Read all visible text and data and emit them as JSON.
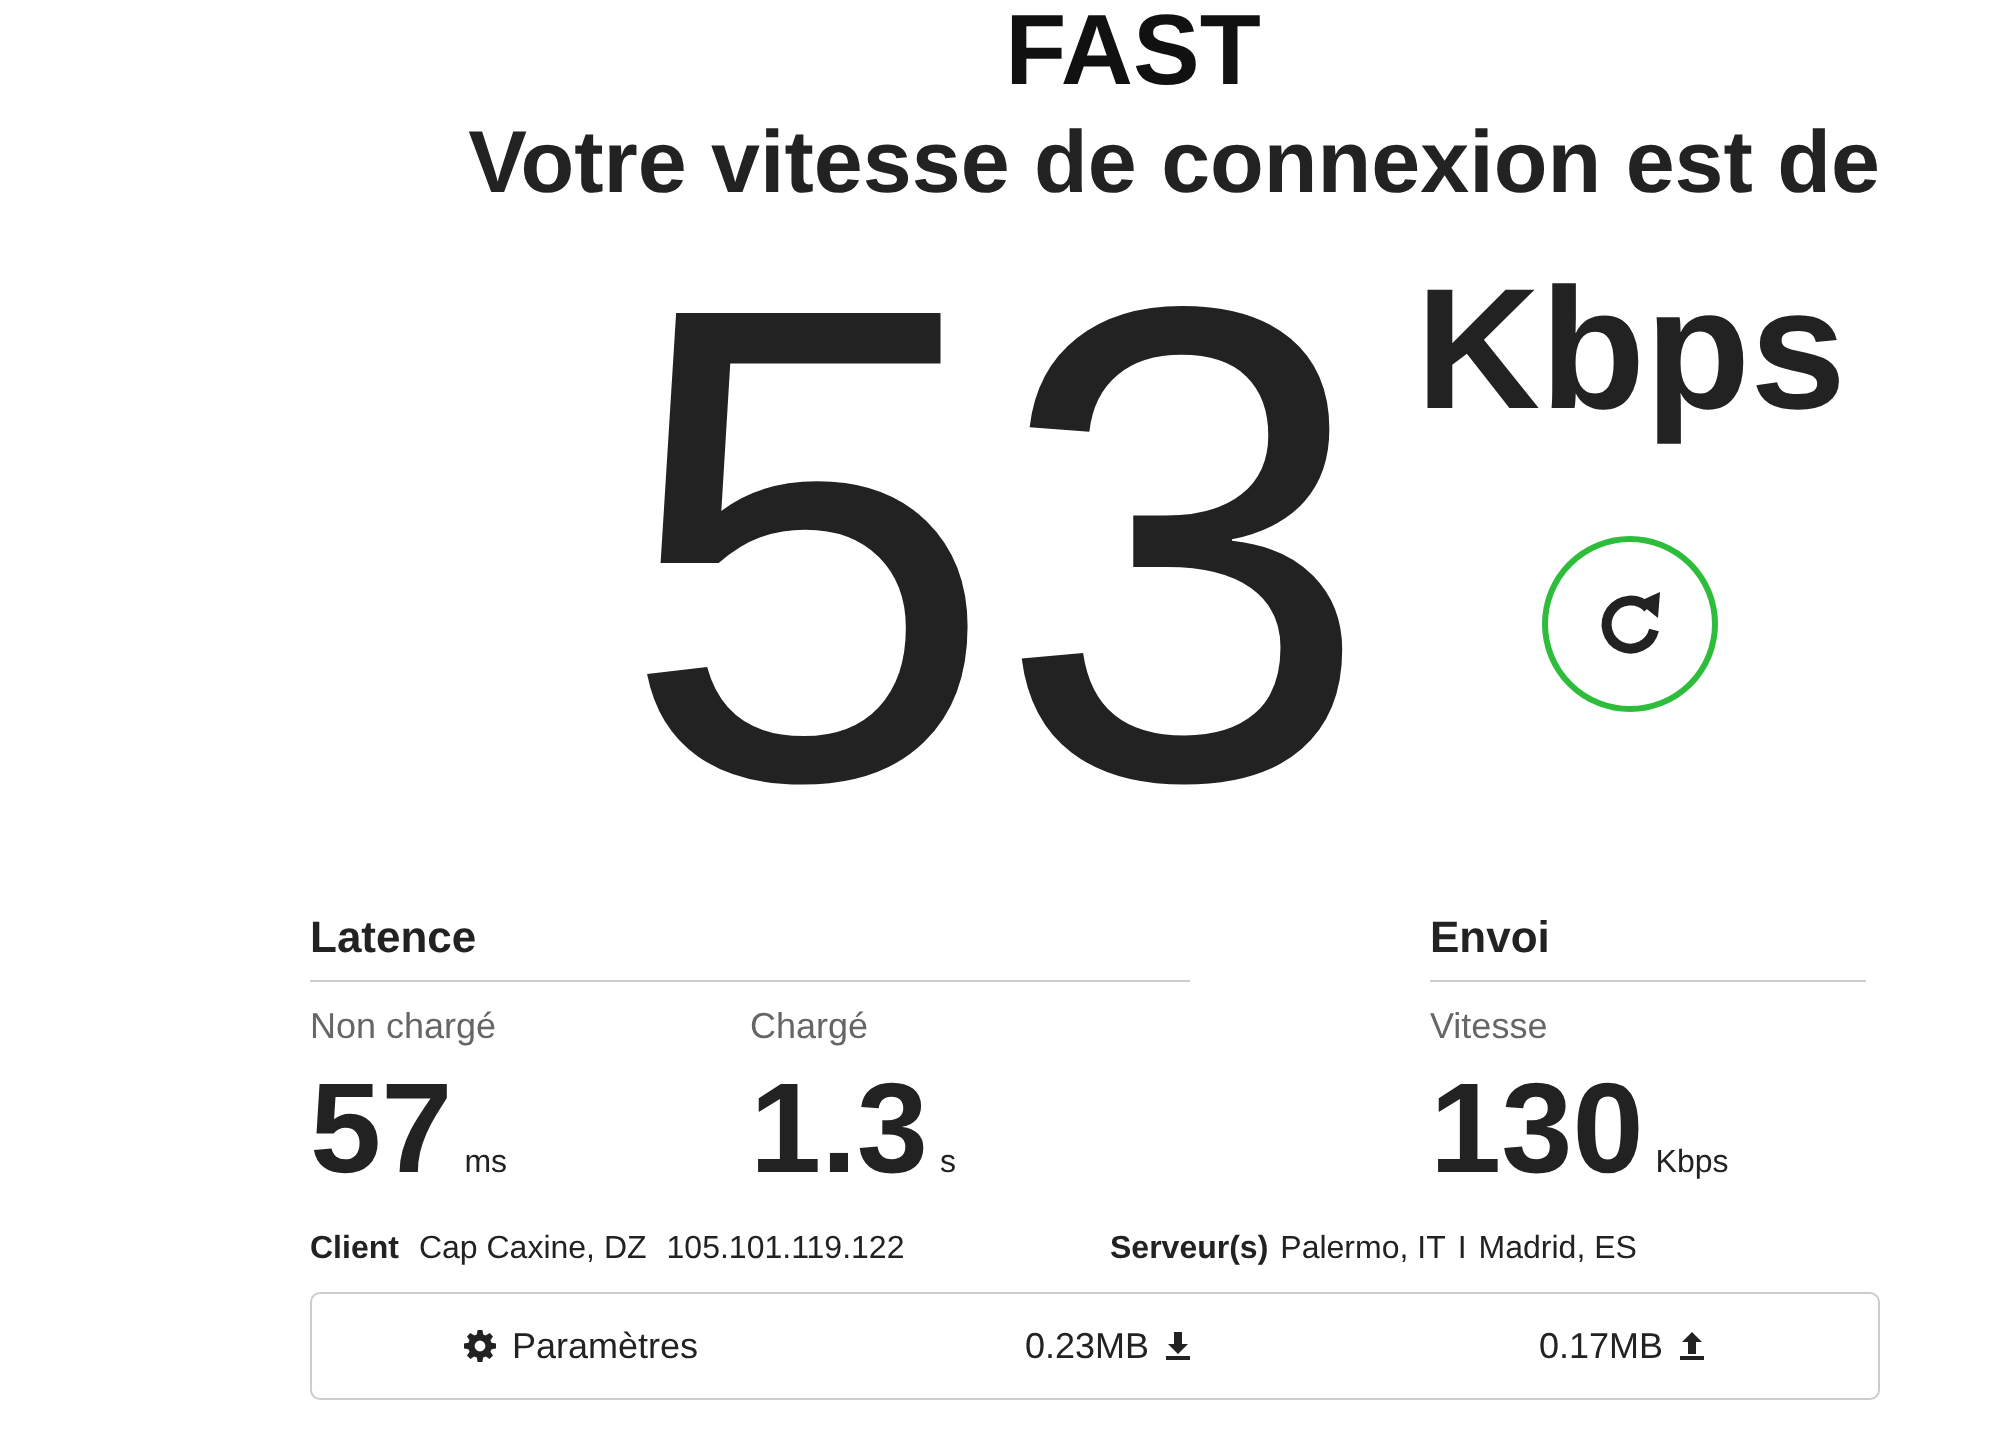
{
  "logo": "FAST",
  "headline": "Votre vitesse de connexion est de",
  "speed": {
    "value": "53",
    "unit": "Kbps"
  },
  "latency": {
    "title": "Latence",
    "metrics": [
      {
        "label": "Non chargé",
        "value": "57",
        "unit": "ms"
      },
      {
        "label": "Chargé",
        "value": "1.3",
        "unit": "s"
      }
    ]
  },
  "upload": {
    "title": "Envoi",
    "metrics": [
      {
        "label": "Vitesse",
        "value": "130",
        "unit": "Kbps"
      }
    ]
  },
  "client": {
    "label": "Client",
    "location": "Cap Caxine, DZ",
    "ip": "105.101.119.122"
  },
  "servers": {
    "label": "Serveur(s)",
    "list": [
      "Palermo, IT",
      "Madrid, ES"
    ],
    "separator": "I"
  },
  "footer": {
    "settings": "Paramètres",
    "download": "0.23MB",
    "upload": "0.17MB"
  }
}
